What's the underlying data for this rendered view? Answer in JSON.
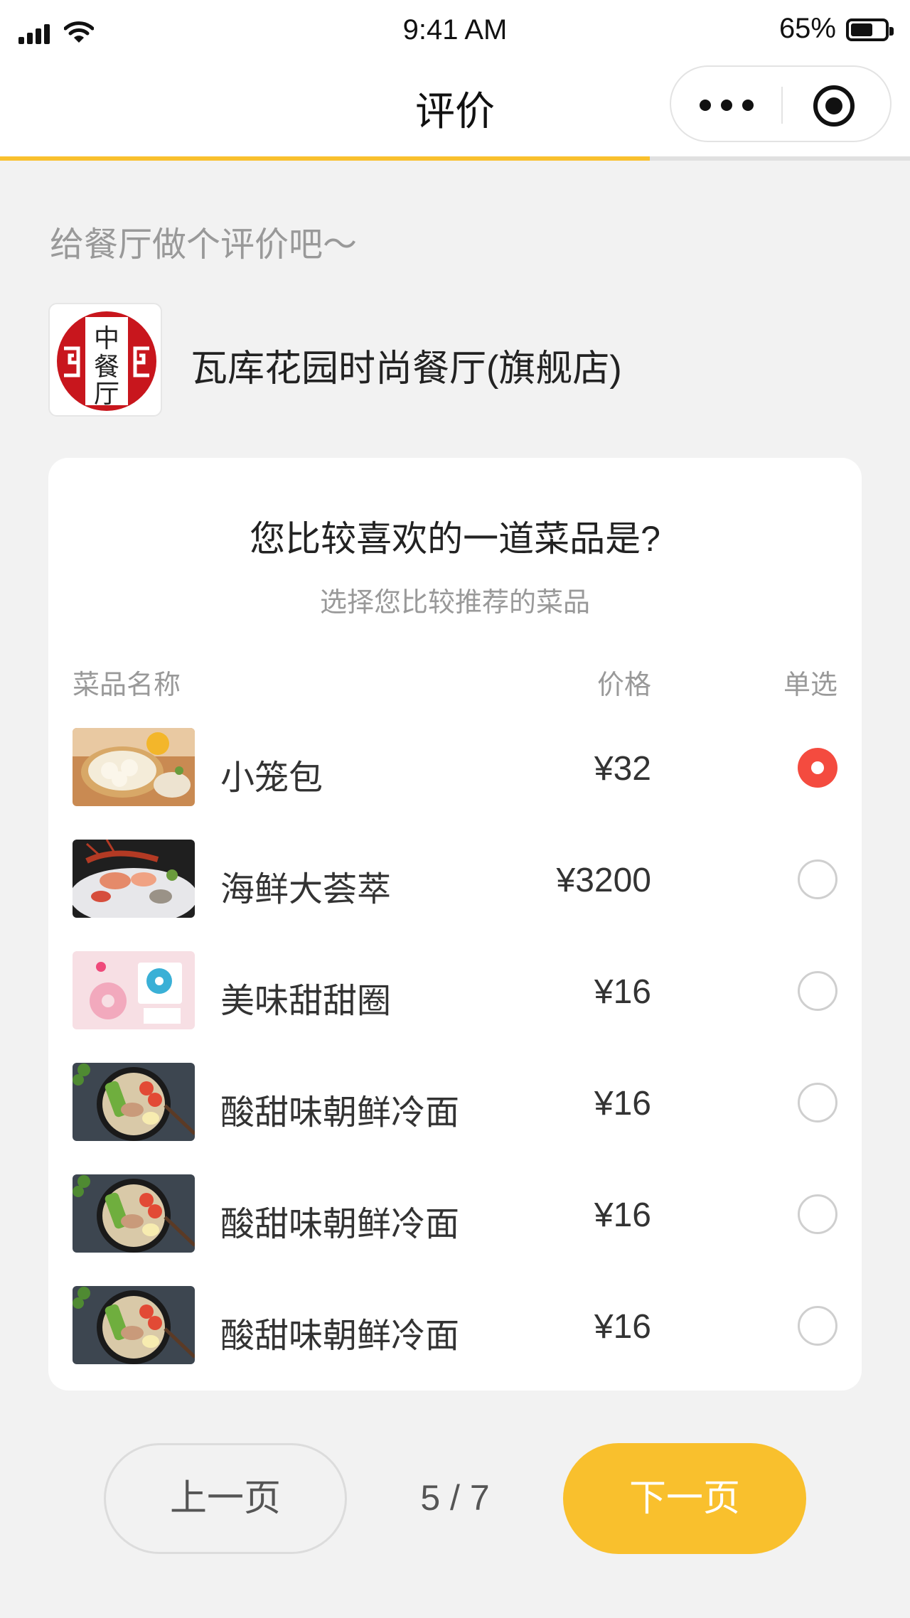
{
  "status_bar": {
    "time": "9:41 AM",
    "battery": "65%",
    "battery_level": 0.65
  },
  "nav": {
    "title": "评价"
  },
  "progress": {
    "fraction": 0.714
  },
  "prompt": "给餐厅做个评价吧～",
  "restaurant": {
    "name": "瓦库花园时尚餐厅(旗舰店)",
    "logo_text": "中餐厅"
  },
  "question": {
    "title": "您比较喜欢的一道菜品是?",
    "subtitle": "选择您比较推荐的菜品"
  },
  "table": {
    "headers": {
      "name": "菜品名称",
      "price": "价格",
      "select": "单选"
    },
    "rows": [
      {
        "name": "小笼包",
        "price": "¥32",
        "selected": true,
        "image": "dumplings-steamer-image"
      },
      {
        "name": "海鲜大荟萃",
        "price": "¥3200",
        "selected": false,
        "image": "seafood-platter-image"
      },
      {
        "name": "美味甜甜圈",
        "price": "¥16",
        "selected": false,
        "image": "donut-image"
      },
      {
        "name": "酸甜味朝鲜冷面",
        "price": "¥16",
        "selected": false,
        "image": "cold-noodles-image"
      },
      {
        "name": "酸甜味朝鲜冷面",
        "price": "¥16",
        "selected": false,
        "image": "cold-noodles-image"
      },
      {
        "name": "酸甜味朝鲜冷面",
        "price": "¥16",
        "selected": false,
        "image": "cold-noodles-image"
      }
    ]
  },
  "pager": {
    "prev_label": "上一页",
    "next_label": "下一页",
    "page_text": "5 / 7"
  },
  "colors": {
    "accent": "#f9c02d",
    "selected": "#f44b3f",
    "logo_red": "#c8161d"
  }
}
